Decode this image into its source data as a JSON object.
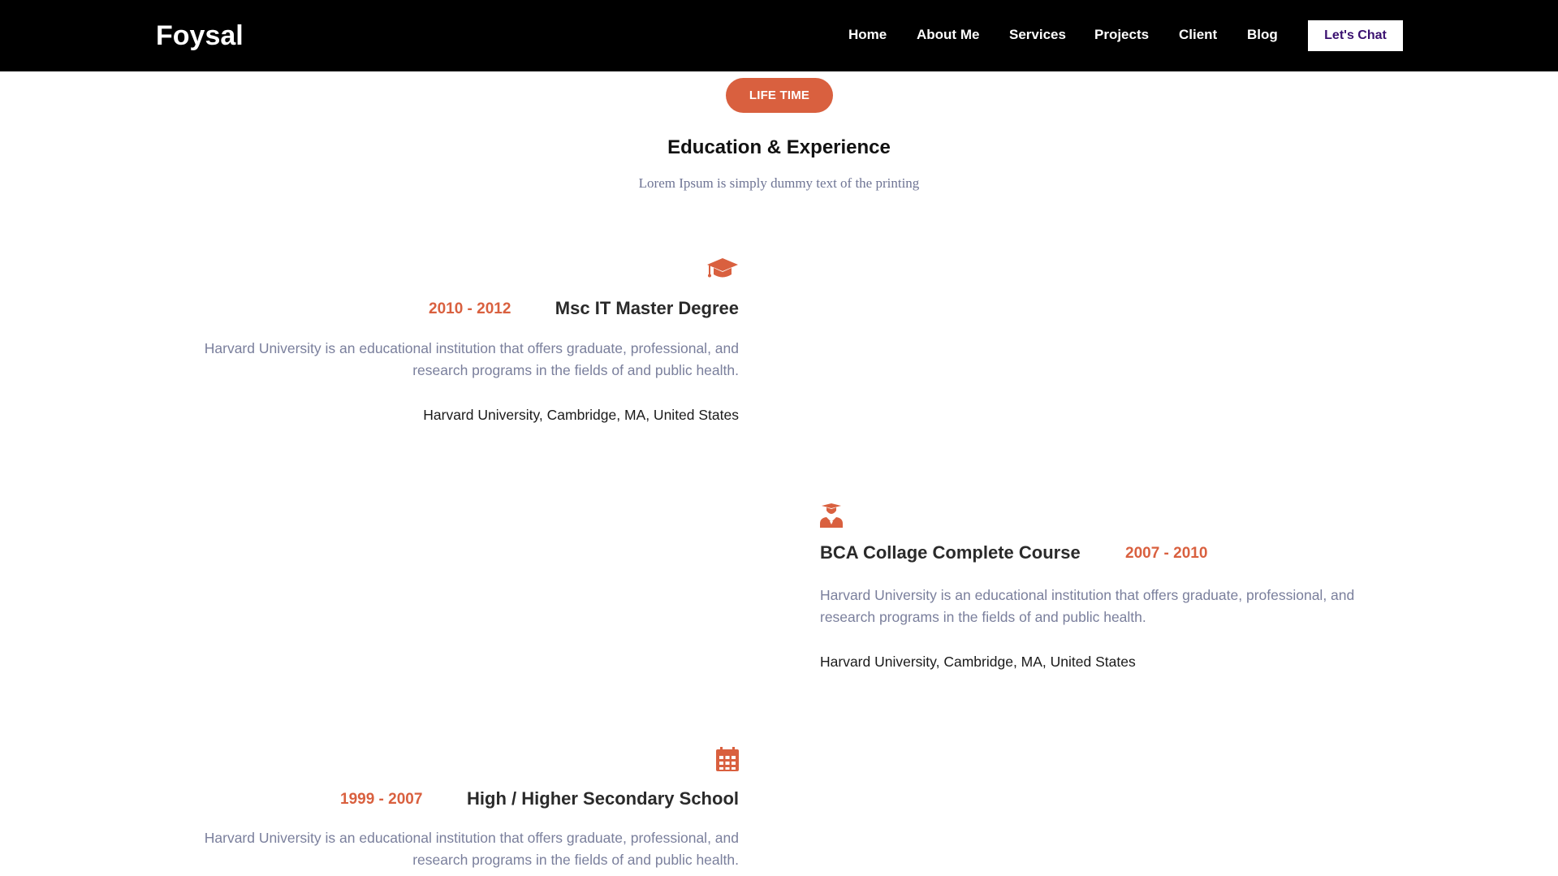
{
  "header": {
    "logo": "Foysal",
    "nav": [
      "Home",
      "About Me",
      "Services",
      "Projects",
      "Client",
      "Blog"
    ],
    "cta": "Let's Chat"
  },
  "section": {
    "badge": "LIFE TIME",
    "title": "Education & Experience",
    "subtitle": "Lorem Ipsum is simply dummy text of the printing"
  },
  "accent_color": "#d9603f",
  "timeline": [
    {
      "icon": "graduation-cap-icon",
      "years": "2010 - 2012",
      "title": "Msc IT Master Degree",
      "description": "Harvard University is an educational institution that offers graduate, professional, and research programs in the fields of and public health.",
      "location": "Harvard University, Cambridge, MA, United States"
    },
    {
      "icon": "user-graduate-icon",
      "years": "2007 - 2010",
      "title": "BCA Collage Complete Course",
      "description": "Harvard University is an educational institution that offers graduate, professional, and research programs in the fields of and public health.",
      "location": "Harvard University, Cambridge, MA, United States"
    },
    {
      "icon": "calendar-icon",
      "years": "1999 - 2007",
      "title": "High / Higher Secondary School",
      "description": "Harvard University is an educational institution that offers graduate, professional, and research programs in the fields of and public health."
    }
  ]
}
